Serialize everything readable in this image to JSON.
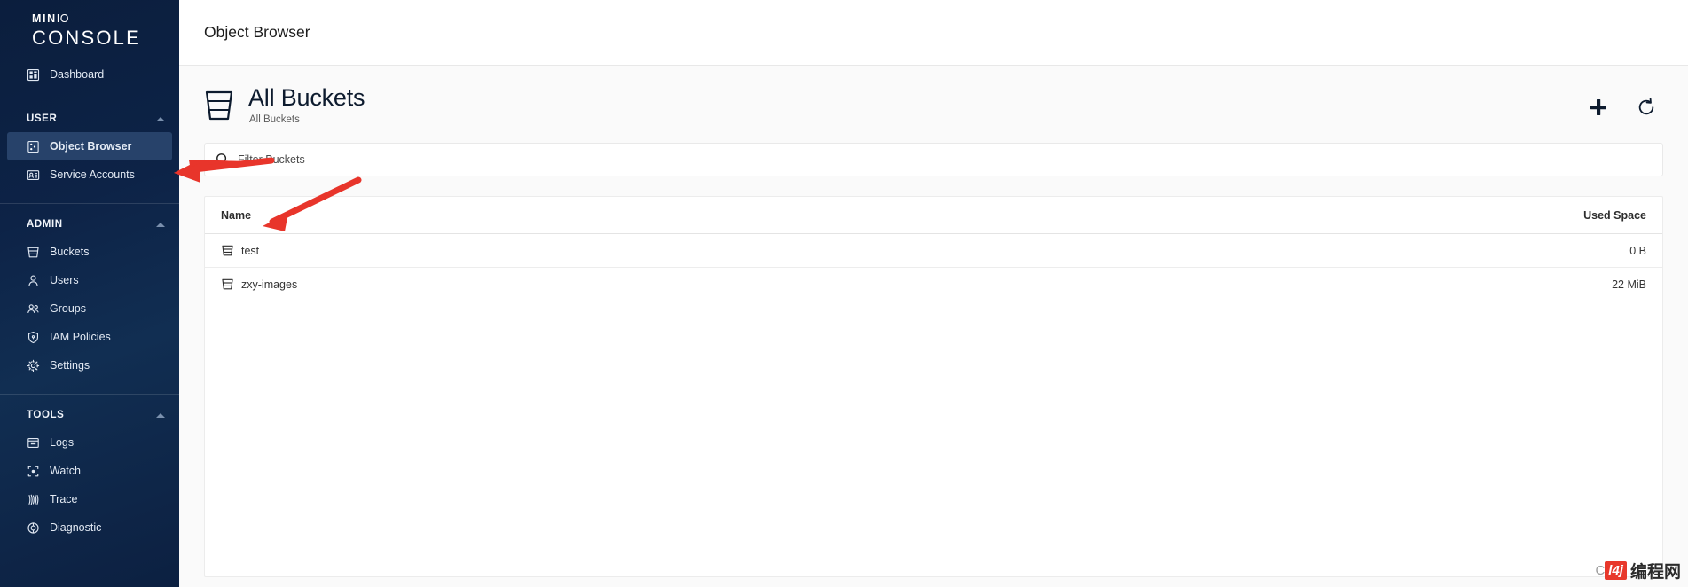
{
  "sidebar": {
    "logo": {
      "mini_pre": "MIN",
      "mini_post": "IO",
      "console": "CONSOLE"
    },
    "top_items": [
      {
        "label": "Dashboard",
        "icon": "dashboard-icon",
        "key": "dashboard"
      }
    ],
    "groups": [
      {
        "label": "USER",
        "key": "user",
        "caret": "chevron-up-icon",
        "items": [
          {
            "label": "Object Browser",
            "icon": "object-browser-icon",
            "key": "object-browser",
            "selected": true
          },
          {
            "label": "Service Accounts",
            "icon": "service-accounts-icon",
            "key": "service-accounts",
            "selected": false
          }
        ]
      },
      {
        "label": "ADMIN",
        "key": "admin",
        "caret": "chevron-up-icon",
        "items": [
          {
            "label": "Buckets",
            "icon": "bucket-icon",
            "key": "buckets",
            "selected": false
          },
          {
            "label": "Users",
            "icon": "user-icon",
            "key": "users",
            "selected": false
          },
          {
            "label": "Groups",
            "icon": "groups-icon",
            "key": "groups",
            "selected": false
          },
          {
            "label": "IAM Policies",
            "icon": "shield-icon",
            "key": "iam-policies",
            "selected": false
          },
          {
            "label": "Settings",
            "icon": "gear-icon",
            "key": "settings",
            "selected": false
          }
        ]
      },
      {
        "label": "TOOLS",
        "key": "tools",
        "caret": "chevron-up-icon",
        "items": [
          {
            "label": "Logs",
            "icon": "logs-icon",
            "key": "logs",
            "selected": false
          },
          {
            "label": "Watch",
            "icon": "watch-icon",
            "key": "watch",
            "selected": false
          },
          {
            "label": "Trace",
            "icon": "trace-icon",
            "key": "trace",
            "selected": false
          },
          {
            "label": "Diagnostic",
            "icon": "diagnostic-icon",
            "key": "diagnostic",
            "selected": false
          }
        ]
      }
    ]
  },
  "topbar": {
    "title": "Object Browser"
  },
  "page_header": {
    "icon": "bucket-icon",
    "title": "All Buckets",
    "subtitle": "All Buckets",
    "actions": [
      {
        "name": "add-bucket-button",
        "icon": "plus-icon"
      },
      {
        "name": "refresh-button",
        "icon": "refresh-icon"
      }
    ]
  },
  "filter": {
    "icon": "search-icon",
    "placeholder": "Filter Buckets",
    "value": ""
  },
  "table": {
    "columns": [
      {
        "label": "Name",
        "align": "left"
      },
      {
        "label": "Used Space",
        "align": "right"
      }
    ],
    "rows": [
      {
        "icon": "bucket-icon",
        "name": "test",
        "used_space": "0 B"
      },
      {
        "icon": "bucket-icon",
        "name": "zxy-images",
        "used_space": "22 MiB"
      }
    ]
  },
  "annotations": [
    {
      "name": "arrow-to-object-browser",
      "color": "#e8352b"
    },
    {
      "name": "arrow-to-test-bucket",
      "color": "#e8352b"
    }
  ],
  "watermark": {
    "prefix": "CS",
    "mark": "l4j",
    "text": "编程网"
  },
  "colors": {
    "sidebar_bg": "#0d2347",
    "sidebar_selected": "#27426a",
    "accent_dark": "#0d1b2e",
    "annotation_red": "#e8352b",
    "page_bg": "#fafafa"
  }
}
